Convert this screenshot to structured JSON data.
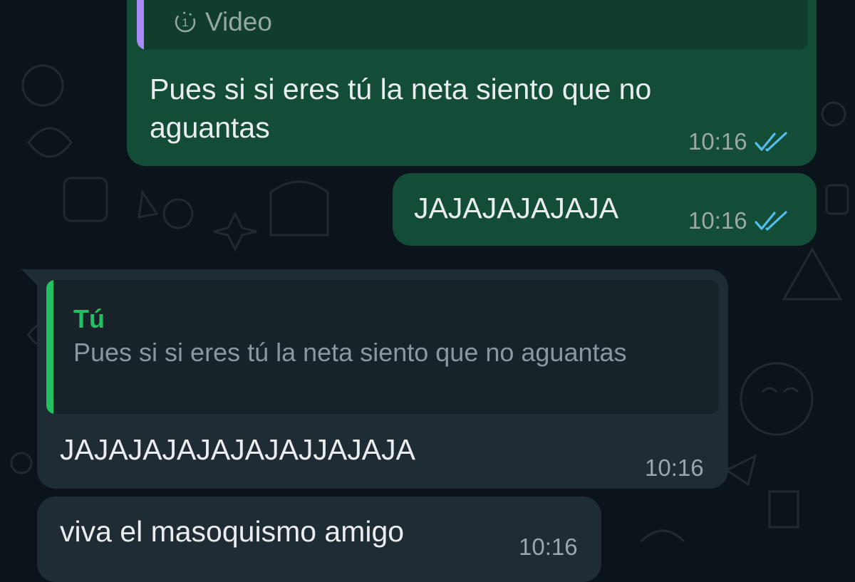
{
  "messages": [
    {
      "id": "m1",
      "direction": "outgoing",
      "quote": {
        "icon": "view-once-icon",
        "text": "Video",
        "bar_color": "#a78bfa"
      },
      "text": "Pues si si eres tú la neta siento que no aguantas",
      "time": "10:16",
      "status": "read"
    },
    {
      "id": "m2",
      "direction": "outgoing",
      "text": "JAJAJAJAJAJA",
      "time": "10:16",
      "status": "read"
    },
    {
      "id": "m3",
      "direction": "incoming",
      "quote": {
        "author": "Tú",
        "text": "Pues si si eres tú la neta siento que no aguantas",
        "bar_color": "#21c063"
      },
      "text": "JAJAJAJAJAJAJAJJAJAJA",
      "time": "10:16"
    },
    {
      "id": "m4",
      "direction": "incoming",
      "text": "viva el masoquismo amigo",
      "time": "10:16"
    }
  ],
  "colors": {
    "background": "#0b141a",
    "outgoing_bubble": "#144d37",
    "incoming_bubble": "#1f2c34",
    "read_ticks": "#53bdeb"
  }
}
